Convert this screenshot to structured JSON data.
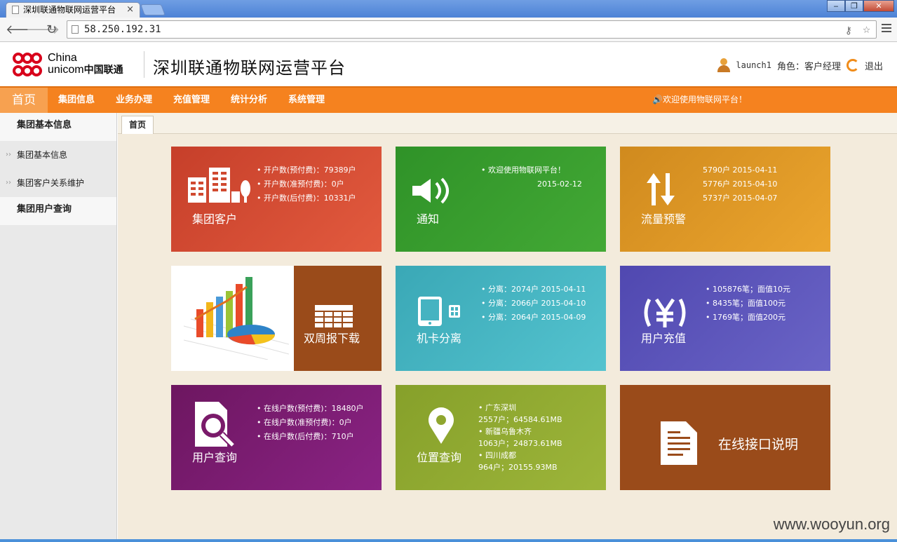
{
  "browser": {
    "tab_title": "深圳联通物联网运营平台",
    "tab_close": "×",
    "url": "58.250.192.31",
    "win_min": "‒",
    "win_max": "❐",
    "win_close": "✕"
  },
  "header": {
    "logo_en_line1": "China",
    "logo_en_line2": "unicom",
    "logo_cn": "中国联通",
    "title": "深圳联通物联网运营平台",
    "username": "launch1",
    "role_label": "角色：客户经理",
    "logout": "退出"
  },
  "nav": {
    "home": "首页",
    "items": [
      "集团信息",
      "业务办理",
      "充值管理",
      "统计分析",
      "系统管理"
    ],
    "welcome": "🔊欢迎使用物联网平台！"
  },
  "sidebar": {
    "section1": "集团基本信息",
    "items": [
      "集团基本信息",
      "集团客户关系维护"
    ],
    "section2": "集团用户查询",
    "chevron": "››"
  },
  "content": {
    "tab": "首页"
  },
  "tiles": {
    "group_customer": {
      "label": "集团客户",
      "lines": [
        "• 开户数(预付费)：79389户",
        "• 开户数(准预付费)：0户",
        "• 开户数(后付费)：10331户"
      ],
      "color": "#d0492f"
    },
    "notice": {
      "label": "通知",
      "lines": [
        "• 欢迎使用物联网平台！",
        "2015-02-12"
      ],
      "color": "#3a9b2a"
    },
    "traffic_alert": {
      "label": "流量预警",
      "lines": [
        "5790户  2015-04-11",
        "5776户  2015-04-10",
        "5737户  2015-04-07"
      ],
      "color": "#e39a26"
    },
    "biweekly": {
      "label": "双周报下载",
      "color": "#9a4b1a"
    },
    "card_separation": {
      "label": "机卡分离",
      "lines": [
        "• 分离：2074户  2015-04-11",
        "• 分离：2066户  2015-04-10",
        "• 分离：2064户  2015-04-09"
      ],
      "color": "#45b3c1"
    },
    "recharge": {
      "label": "用户充值",
      "lines": [
        "• 105876笔；面值10元",
        "• 8435笔；面值100元",
        "• 1769笔；面值200元"
      ],
      "color": "#5b55b8"
    },
    "user_query": {
      "label": "用户查询",
      "lines": [
        "• 在线户数(预付费)：18480户",
        "• 在线户数(准预付费)：0户",
        "• 在线户数(后付费)：710户"
      ],
      "color": "#7a1a6a"
    },
    "location": {
      "label": "位置查询",
      "lines": [
        "• 广东深圳",
        "2557户；64584.61MB",
        "• 新疆乌鲁木齐",
        "1063户；24873.61MB",
        "• 四川成都",
        "964户；20155.93MB"
      ],
      "color": "#8fa62f"
    },
    "api_doc": {
      "label": "在线接口说明",
      "color": "#9a4b1a"
    }
  },
  "watermark": "www.wooyun.org"
}
